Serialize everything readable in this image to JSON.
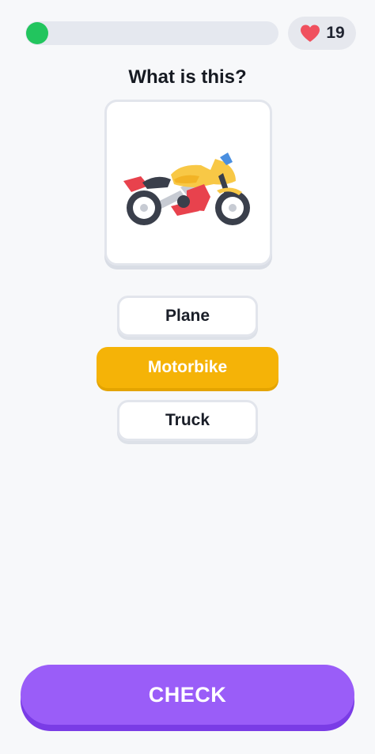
{
  "progress": {
    "fraction": 0.05,
    "color": "#22c55e"
  },
  "lives": {
    "count": "19",
    "icon": "heart-icon",
    "color": "#f0505e"
  },
  "question": {
    "text": "What is this?"
  },
  "image": {
    "subject": "motorbike-illustration"
  },
  "options": [
    {
      "label": "Plane",
      "selected": false
    },
    {
      "label": "Motorbike",
      "selected": true
    },
    {
      "label": "Truck",
      "selected": false
    }
  ],
  "check_button": {
    "label": "CHECK"
  },
  "colors": {
    "selected_option": "#f5b307",
    "check_button": "#9a5df8",
    "background": "#f7f8fa"
  }
}
